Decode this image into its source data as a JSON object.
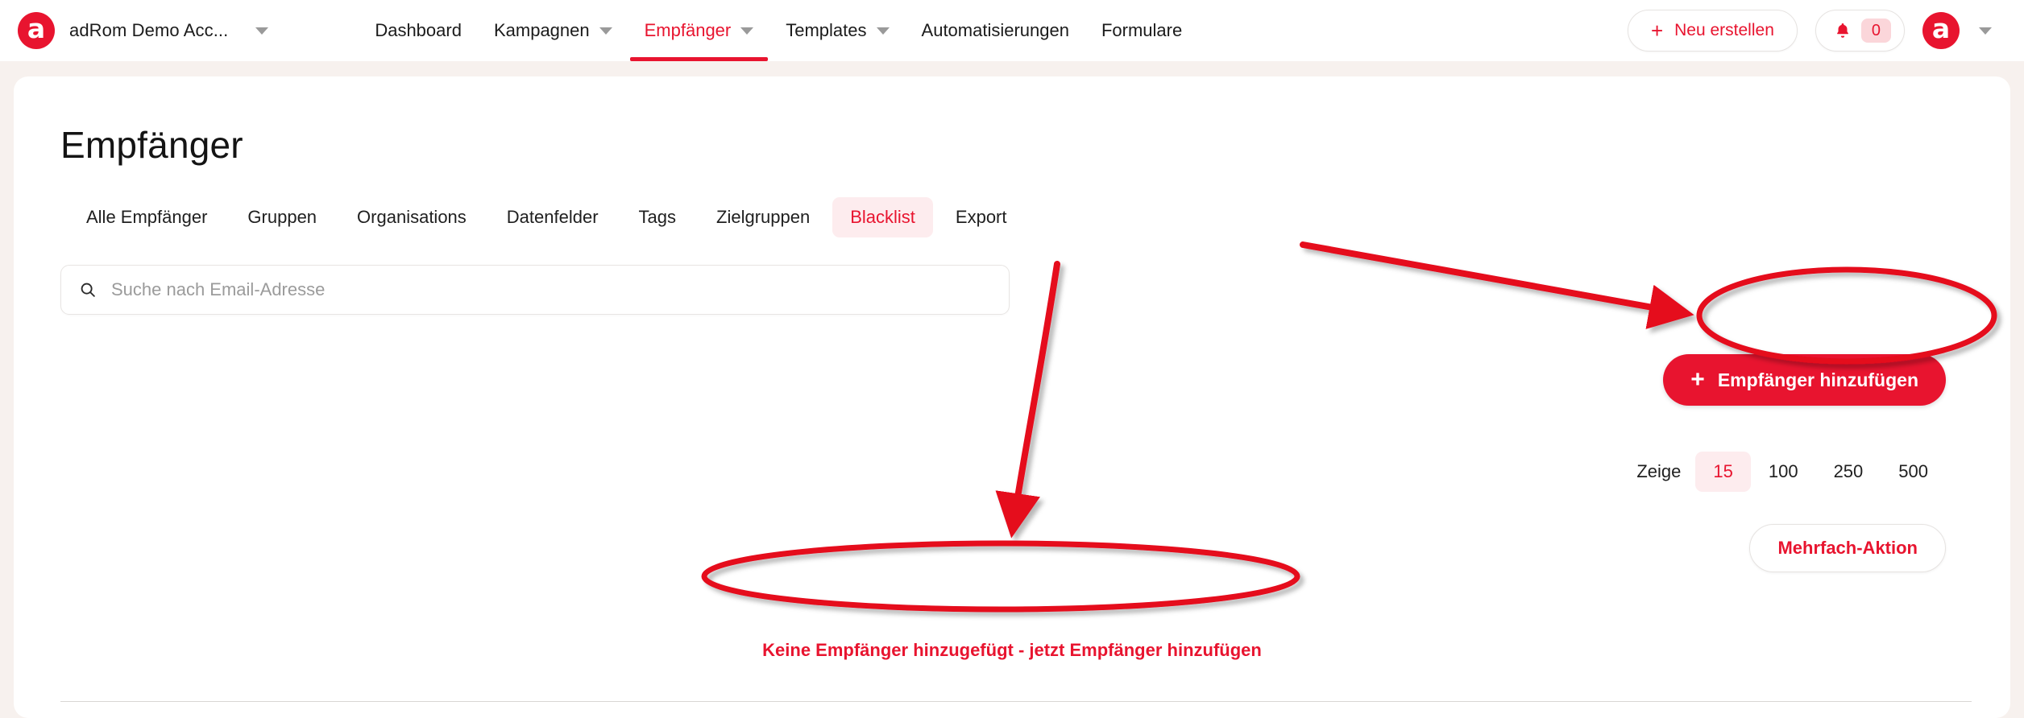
{
  "colors": {
    "brand_red": "#e8142f",
    "page_bg": "#f7f1ee",
    "card_bg": "#ffffff",
    "tab_active_bg": "#fdecee",
    "annotation_red": "#e5071b"
  },
  "topbar": {
    "logo_letter": "a",
    "account_name": "adRom Demo Acc...",
    "account_caret_icon": "chevron-down-icon",
    "nav_items": [
      {
        "label": "Dashboard",
        "has_caret": false,
        "active": false
      },
      {
        "label": "Kampagnen",
        "has_caret": true,
        "active": false
      },
      {
        "label": "Empfänger",
        "has_caret": true,
        "active": true
      },
      {
        "label": "Templates",
        "has_caret": true,
        "active": false
      },
      {
        "label": "Automatisierungen",
        "has_caret": false,
        "active": false
      },
      {
        "label": "Formulare",
        "has_caret": false,
        "active": false
      }
    ],
    "new_button": {
      "label": "Neu erstellen",
      "plus": "+",
      "icon": "plus-icon"
    },
    "notifications": {
      "count": "0",
      "icon": "bell-icon"
    },
    "avatar_letter": "a",
    "avatar_caret_icon": "chevron-down-icon"
  },
  "main": {
    "page_title": "Empfänger",
    "tabs": [
      {
        "label": "Alle Empfänger",
        "active": false
      },
      {
        "label": "Gruppen",
        "active": false
      },
      {
        "label": "Organisations",
        "active": false
      },
      {
        "label": "Datenfelder",
        "active": false
      },
      {
        "label": "Tags",
        "active": false
      },
      {
        "label": "Zielgruppen",
        "active": false
      },
      {
        "label": "Blacklist",
        "active": true
      },
      {
        "label": "Export",
        "active": false
      }
    ],
    "search": {
      "placeholder": "Suche nach Email-Adresse",
      "value": "",
      "icon": "search-icon"
    },
    "add_button": {
      "label": "Empfänger hinzufügen",
      "plus": "+",
      "icon": "plus-icon"
    },
    "pager": {
      "label": "Zeige",
      "options": [
        {
          "value": "15",
          "active": true
        },
        {
          "value": "100",
          "active": false
        },
        {
          "value": "250",
          "active": false
        },
        {
          "value": "500",
          "active": false
        }
      ]
    },
    "multi_action_button": {
      "label": "Mehrfach-Aktion"
    },
    "empty_state": {
      "text": "Keine Empfänger hinzugefügt - jetzt Empfänger hinzufügen"
    }
  },
  "annotations": {
    "ellipse_add_button": "red-ellipse-highlight",
    "ellipse_empty_state": "red-ellipse-highlight",
    "arrow_to_add_button": "red-arrow",
    "arrow_to_empty_state": "red-arrow"
  }
}
